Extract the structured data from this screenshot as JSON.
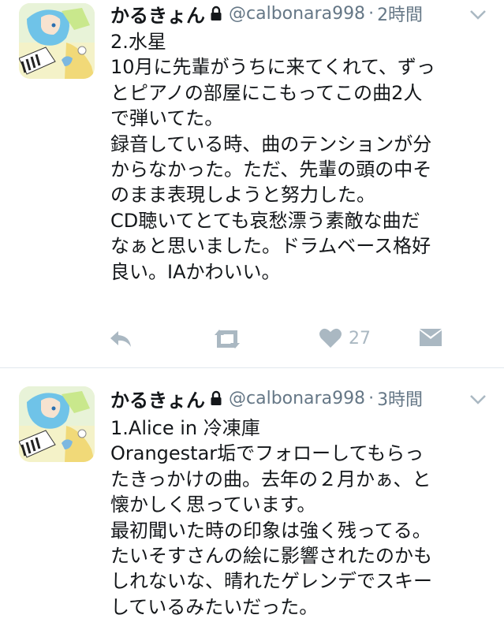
{
  "tweets": [
    {
      "name": "かるきょん",
      "handle": "@calbonara998",
      "separator": "·",
      "time": "2時間",
      "lines": [
        "2.水星",
        "10月に先輩がうちに来てくれて、ずっ",
        "とピアノの部屋にこもってこの曲2人",
        "で弾いてた。",
        "録音している時、曲のテンションが分",
        "からなかった。ただ、先輩の頭の中そ",
        "のまま表現しようと努力した。",
        "CD聴いてとても哀愁漂う素敵な曲だ",
        "なぁと思いました。ドラムベース格好",
        "良い。IAかわいい。"
      ],
      "like_count": "27"
    },
    {
      "name": "かるきょん",
      "handle": "@calbonara998",
      "separator": "·",
      "time": "3時間",
      "lines": [
        "1.Alice in 冷凍庫",
        "Orangestar垢でフォローしてもらっ",
        "たきっかけの曲。去年の２月かぁ、と",
        "懐かしく思っています。",
        "最初聞いた時の印象は強く残ってる。",
        "たいそすさんの絵に影響されたのかも",
        "しれないな、晴れたゲレンデでスキー",
        "しているみたいだった。"
      ]
    }
  ],
  "colors": {
    "text": "#14171a",
    "secondary": "#657786",
    "icon": "#aab8c2",
    "divider": "#e1e8ed"
  },
  "icons": [
    "reply-icon",
    "retweet-icon",
    "heart-icon",
    "dm-icon",
    "lock-icon",
    "chevron-down-icon"
  ]
}
